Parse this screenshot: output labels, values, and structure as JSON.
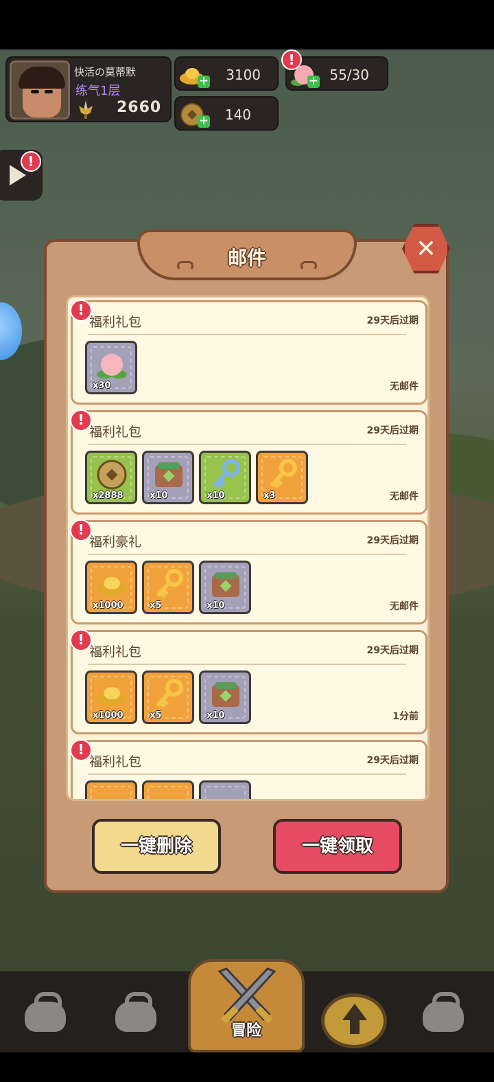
{
  "player": {
    "name": "快活の莫蒂默",
    "rank": "练气1层",
    "power": "2660"
  },
  "resources": {
    "gold_ingot": "3100",
    "peach": "55/30",
    "coin": "140"
  },
  "modal": {
    "title": "邮件",
    "close_icon": "close-icon"
  },
  "mails": [
    {
      "name": "福利礼包",
      "expire": "29天后过期",
      "status": "无邮件",
      "items": [
        {
          "icon": "peach",
          "qty": "x30",
          "bg": "gray"
        }
      ]
    },
    {
      "name": "福利礼包",
      "expire": "29天后过期",
      "status": "无邮件",
      "items": [
        {
          "icon": "coin",
          "qty": "x2888",
          "bg": "green"
        },
        {
          "icon": "chest",
          "qty": "x10",
          "bg": "gray"
        },
        {
          "icon": "key-blue",
          "qty": "x10",
          "bg": "green"
        },
        {
          "icon": "key-gold",
          "qty": "x3",
          "bg": "orange"
        }
      ]
    },
    {
      "name": "福利豪礼",
      "expire": "29天后过期",
      "status": "无邮件",
      "items": [
        {
          "icon": "gold-ingot",
          "qty": "x1000",
          "bg": "orange"
        },
        {
          "icon": "key-gold",
          "qty": "x5",
          "bg": "orange"
        },
        {
          "icon": "chest",
          "qty": "x10",
          "bg": "gray"
        }
      ]
    },
    {
      "name": "福利礼包",
      "expire": "29天后过期",
      "status": "1分前",
      "items": [
        {
          "icon": "gold-ingot",
          "qty": "x1000",
          "bg": "orange"
        },
        {
          "icon": "key-gold",
          "qty": "x5",
          "bg": "orange"
        },
        {
          "icon": "chest",
          "qty": "x10",
          "bg": "gray"
        }
      ]
    },
    {
      "name": "福利礼包",
      "expire": "29天后过期",
      "status": "",
      "items": [
        {
          "icon": "gold-ingot",
          "qty": "",
          "bg": "orange"
        },
        {
          "icon": "key-gold",
          "qty": "",
          "bg": "orange"
        },
        {
          "icon": "chest",
          "qty": "",
          "bg": "gray"
        }
      ]
    }
  ],
  "buttons": {
    "delete_all": "一键删除",
    "claim_all": "一键领取"
  },
  "nav": {
    "adventure": "冒险"
  },
  "alert_mark": "!",
  "colors": {
    "alert": "#e23a4e",
    "claim": "#e84c64",
    "delete": "#f3d98e",
    "rank": "#b38cf5"
  }
}
